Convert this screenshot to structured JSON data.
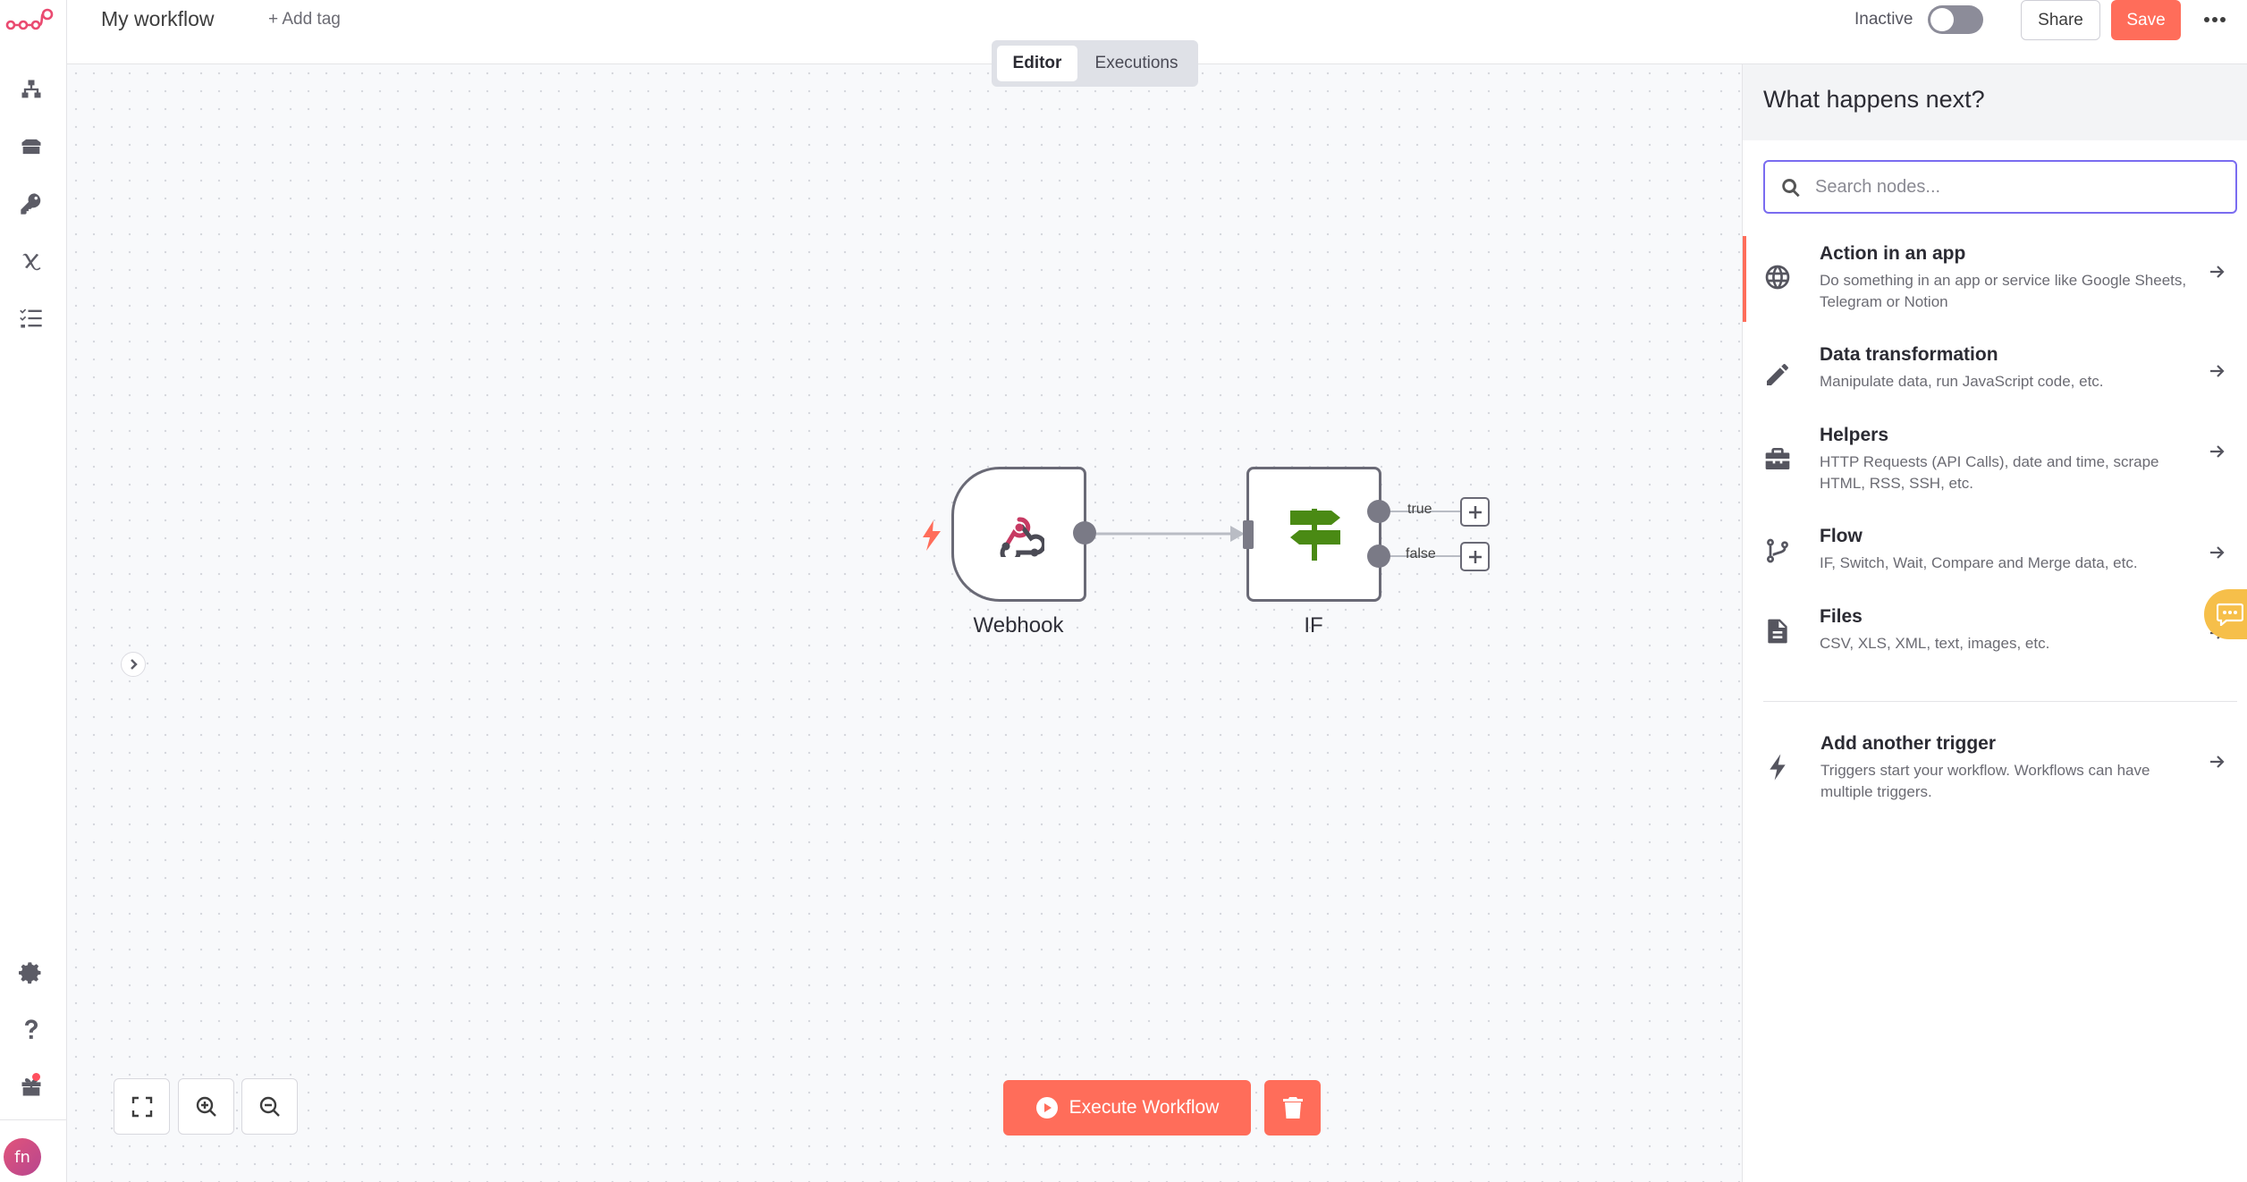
{
  "header": {
    "workflow_name": "My workflow",
    "add_tag": "+ Add tag",
    "tabs": [
      {
        "label": "Editor",
        "active": true
      },
      {
        "label": "Executions",
        "active": false
      }
    ],
    "active_state_label": "Inactive",
    "active": false,
    "share_label": "Share",
    "save_label": "Save"
  },
  "sidebar": {
    "logo_icon": "n8n-logo-icon",
    "top_items": [
      "workflows-icon",
      "templates-icon",
      "credentials-icon",
      "variables-icon",
      "executions-icon"
    ],
    "bottom_items": [
      "settings-icon",
      "help-icon",
      "gift-icon"
    ],
    "avatar_initials": "fn"
  },
  "canvas": {
    "nodes": [
      {
        "name": "Webhook",
        "icon": "webhook-icon",
        "trigger": true
      },
      {
        "name": "IF",
        "icon": "signpost-icon",
        "trigger": false
      }
    ],
    "branches": [
      {
        "label": "true"
      },
      {
        "label": "false"
      }
    ],
    "execute_label": "Execute Workflow",
    "controls": [
      "fit-view-icon",
      "zoom-in-icon",
      "zoom-out-icon"
    ]
  },
  "panel": {
    "title": "What happens next?",
    "search_placeholder": "Search nodes...",
    "categories": [
      {
        "title": "Action in an app",
        "description": "Do something in an app or service like Google Sheets, Telegram or Notion",
        "icon": "globe-icon"
      },
      {
        "title": "Data transformation",
        "description": "Manipulate data, run JavaScript code, etc.",
        "icon": "pencil-icon"
      },
      {
        "title": "Helpers",
        "description": "HTTP Requests (API Calls), date and time, scrape HTML, RSS, SSH, etc.",
        "icon": "toolbox-icon"
      },
      {
        "title": "Flow",
        "description": "IF, Switch, Wait, Compare and Merge data, etc.",
        "icon": "branch-icon"
      },
      {
        "title": "Files",
        "description": "CSV, XLS, XML, text, images, etc.",
        "icon": "file-icon"
      }
    ],
    "trigger_item": {
      "title": "Add another trigger",
      "description": "Triggers start your workflow. Workflows can have multiple triggers.",
      "icon": "bolt-icon"
    }
  },
  "colors": {
    "accent": "#ff6d5a",
    "search_focus": "#7a6cf0",
    "if_node_green": "#4a8a14",
    "webhook_pink": "#c73a63"
  }
}
